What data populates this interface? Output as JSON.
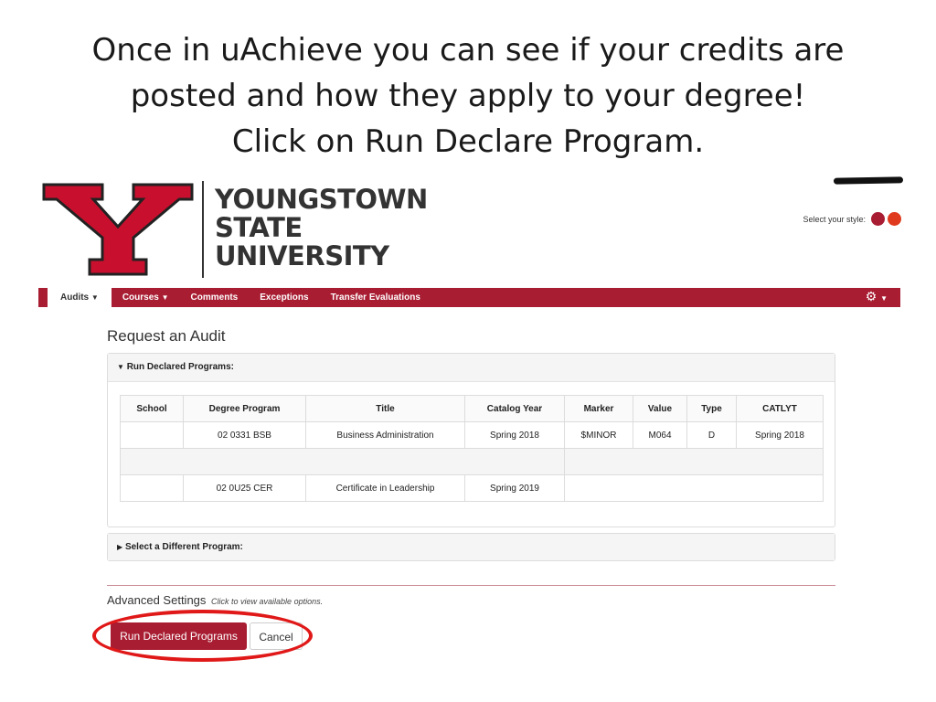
{
  "slide": {
    "title_lines": [
      "Once in uAchieve you can see if your credits are",
      "posted and how they apply to your degree!",
      "Click on Run Declare Program."
    ]
  },
  "brand": {
    "name_lines": [
      "YOUNGSTOWN",
      "STATE",
      "UNIVERSITY"
    ],
    "accent_color": "#a81d32"
  },
  "style_picker": {
    "label": "Select your style:",
    "options": [
      "#a81d32",
      "#e03a1e"
    ]
  },
  "nav": {
    "items": [
      {
        "label": "Audits",
        "dropdown": true,
        "active": true
      },
      {
        "label": "Courses",
        "dropdown": true
      },
      {
        "label": "Comments"
      },
      {
        "label": "Exceptions"
      },
      {
        "label": "Transfer Evaluations"
      }
    ],
    "settings_icon": "gear-icon"
  },
  "page": {
    "heading": "Request an Audit",
    "declared_panel": {
      "title": "Run Declared Programs:",
      "columns": [
        "School",
        "Degree Program",
        "Title",
        "Catalog Year",
        "Marker",
        "Value",
        "Type",
        "CATLYT"
      ],
      "rows": [
        [
          "",
          "02 0331 BSB",
          "Business Administration",
          "Spring 2018",
          "$MINOR",
          "M064",
          "D",
          "Spring 2018"
        ],
        [
          "",
          "",
          "",
          "",
          "",
          "",
          "",
          ""
        ],
        [
          "",
          "02 0U25 CER",
          "Certificate in Leadership",
          "Spring 2019",
          "",
          "",
          "",
          ""
        ]
      ]
    },
    "different_panel": {
      "title": "Select a Different Program:"
    },
    "advanced": {
      "label": "Advanced Settings",
      "hint": "Click to view available options."
    },
    "buttons": {
      "run": "Run Declared Programs",
      "cancel": "Cancel"
    }
  }
}
